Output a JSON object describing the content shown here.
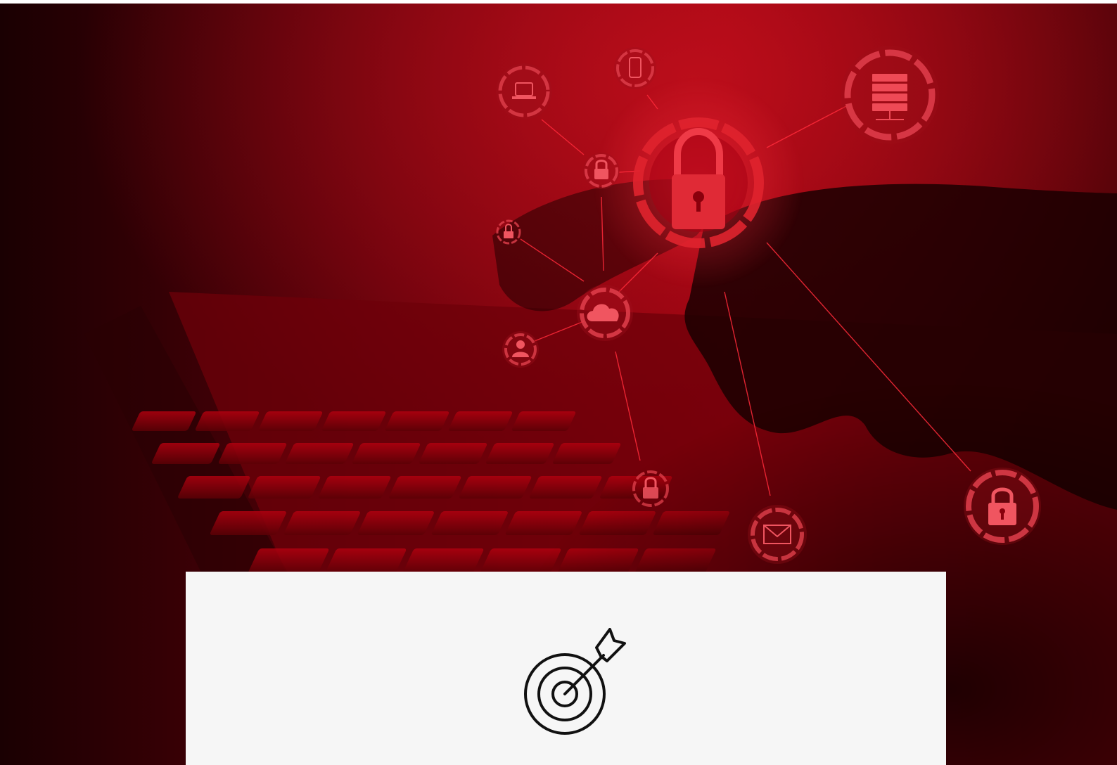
{
  "hero": {
    "background_icon": "cybersecurity-network-hero-image",
    "accent_color": "#c3141f",
    "overlay_color": "#8a0008",
    "node_icons": [
      "laptop-icon",
      "smartphone-icon",
      "server-icon",
      "padlock-icon",
      "cloud-icon",
      "user-icon",
      "envelope-icon"
    ]
  },
  "card": {
    "background_color": "#f6f6f6",
    "icon": "target-icon"
  }
}
